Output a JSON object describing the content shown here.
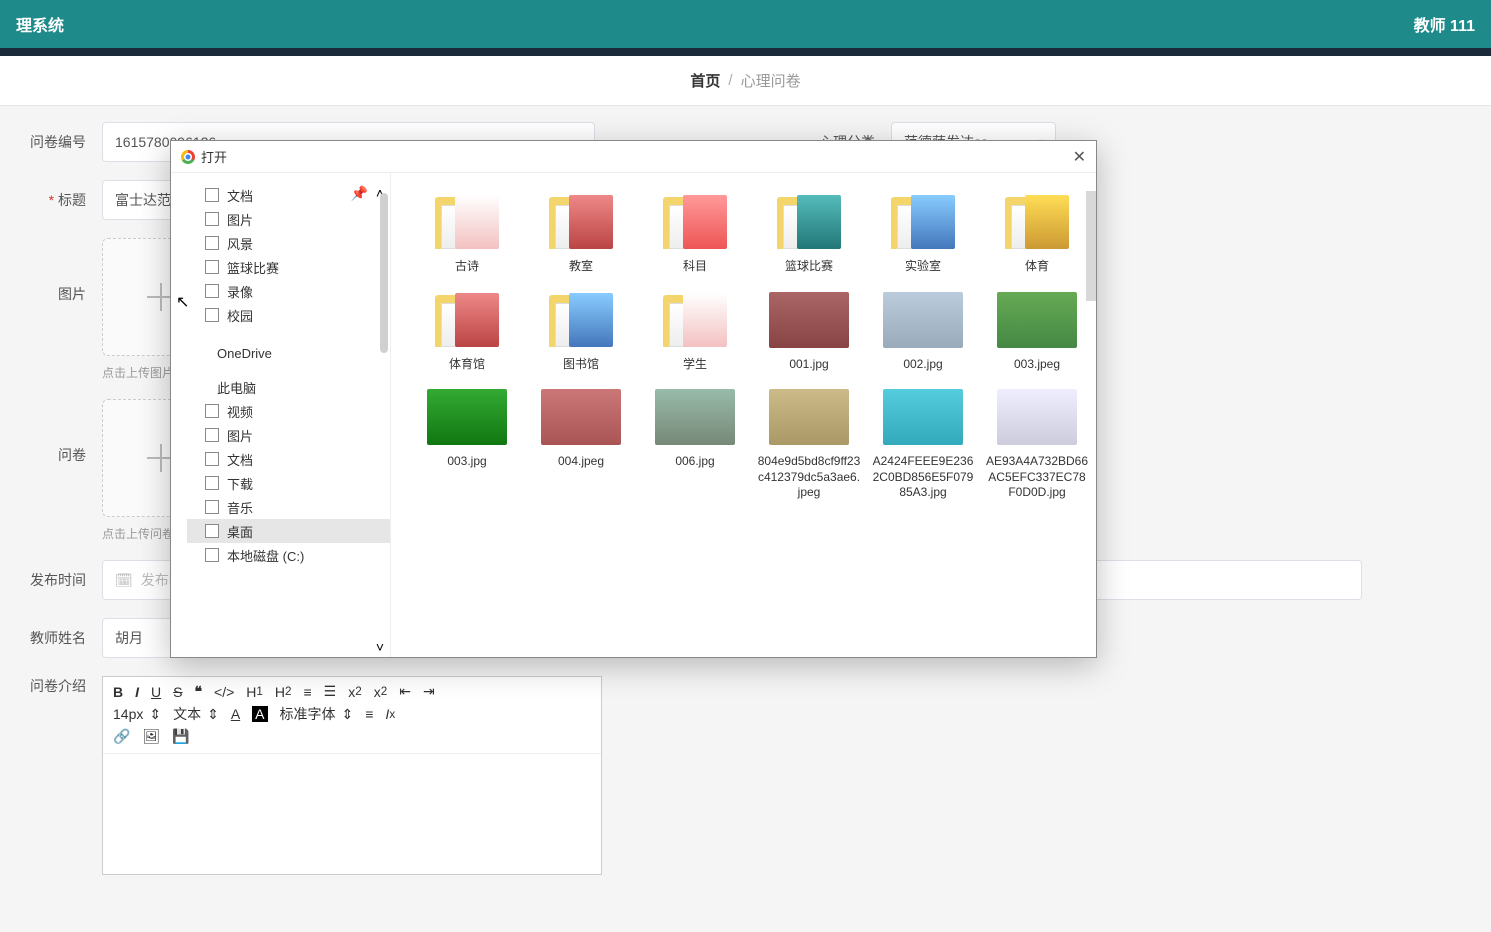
{
  "header": {
    "system_title": "理系统",
    "user_label": "教师 111"
  },
  "breadcrumb": {
    "home": "首页",
    "separator": "/",
    "current": "心理问卷"
  },
  "form": {
    "id_label": "问卷编号",
    "id_value": "1615780096126",
    "category_label": "心理分类",
    "category_value": "范德萨发达ss",
    "title_label": "标题",
    "title_value": "富士达范德萨",
    "image_label": "图片",
    "image_hint": "点击上传图片",
    "survey_label": "问卷",
    "survey_hint": "点击上传问卷",
    "publish_label": "发布时间",
    "publish_placeholder": "发布时间",
    "teacher_label": "教师姓名",
    "teacher_value": "胡月",
    "intro_label": "问卷介绍"
  },
  "editor": {
    "font_size": "14px",
    "text_menu": "文本",
    "font_family": "标准字体"
  },
  "dialog": {
    "title": "打开",
    "side": {
      "quick": [
        {
          "label": "文档"
        },
        {
          "label": "图片"
        },
        {
          "label": "风景"
        },
        {
          "label": "篮球比赛"
        },
        {
          "label": "录像"
        },
        {
          "label": "校园"
        }
      ],
      "onedrive": "OneDrive",
      "thispc": "此电脑",
      "pc_children": [
        {
          "label": "视频"
        },
        {
          "label": "图片"
        },
        {
          "label": "文档"
        },
        {
          "label": "下载"
        },
        {
          "label": "音乐"
        },
        {
          "label": "桌面",
          "selected": true
        },
        {
          "label": "本地磁盘 (C:)"
        }
      ]
    },
    "items": [
      {
        "type": "folder",
        "name": "古诗",
        "over": "fc1"
      },
      {
        "type": "folder",
        "name": "教室",
        "over": "fc2"
      },
      {
        "type": "folder",
        "name": "科目",
        "over": "fc3"
      },
      {
        "type": "folder",
        "name": "篮球比赛",
        "over": "fc4"
      },
      {
        "type": "folder",
        "name": "实验室",
        "over": "fc6"
      },
      {
        "type": "folder",
        "name": "体育",
        "over": "fc5"
      },
      {
        "type": "folder",
        "name": "体育馆",
        "over": "fc2"
      },
      {
        "type": "folder",
        "name": "图书馆",
        "over": "fc6"
      },
      {
        "type": "folder",
        "name": "学生",
        "over": "fc1"
      },
      {
        "type": "image",
        "name": "001.jpg",
        "bg": "linear-gradient(#a66,#844)"
      },
      {
        "type": "image",
        "name": "002.jpg",
        "bg": "linear-gradient(#bcd,#9ab)"
      },
      {
        "type": "image",
        "name": "003.jpeg",
        "bg": "linear-gradient(#6a5,#484)"
      },
      {
        "type": "image",
        "name": "003.jpg",
        "bg": "linear-gradient(#3a3,#171)"
      },
      {
        "type": "image",
        "name": "004.jpeg",
        "bg": "linear-gradient(#c77,#a55)"
      },
      {
        "type": "image",
        "name": "006.jpg",
        "bg": "linear-gradient(#9ba,#787)"
      },
      {
        "type": "image",
        "name": "804e9d5bd8cf9ff23c412379dc5a3ae6.jpeg",
        "bg": "linear-gradient(#cb8,#a96)"
      },
      {
        "type": "image",
        "name": "A2424FEEE9E2362C0BD856E5F07985A3.jpg",
        "bg": "linear-gradient(#5cd,#3ab)"
      },
      {
        "type": "image",
        "name": "AE93A4A732BD66AC5EFC337EC78F0D0D.jpg",
        "bg": "linear-gradient(#eef,#ccd)"
      }
    ]
  }
}
